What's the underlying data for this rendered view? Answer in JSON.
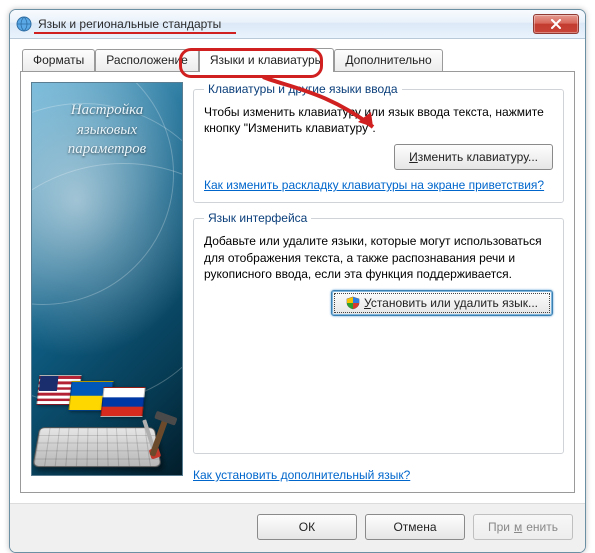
{
  "window": {
    "title": "Язык и региональные стандарты"
  },
  "tabs": [
    {
      "label": "Форматы"
    },
    {
      "label": "Расположение"
    },
    {
      "label": "Языки и клавиатуры"
    },
    {
      "label": "Дополнительно"
    }
  ],
  "sidebar": {
    "line1": "Настройка",
    "line2": "языковых",
    "line3": "параметров"
  },
  "group_keyboards": {
    "legend": "Клавиатуры и другие языки ввода",
    "desc": "Чтобы изменить клавиатуру или язык ввода текста, нажмите кнопку \"Изменить клавиатуру\".",
    "button_pre": "И",
    "button_rest": "зменить клавиатуру...",
    "link": "Как изменить раскладку клавиатуры на экране приветствия?"
  },
  "group_interface": {
    "legend": "Язык интерфейса",
    "desc": "Добавьте или удалите языки, которые могут использоваться для отображения текста, а также распознавания речи и рукописного ввода, если эта функция поддерживается.",
    "button_pre": "У",
    "button_rest": "становить или удалить язык..."
  },
  "footer_link": "Как установить дополнительный язык?",
  "buttons": {
    "ok": "ОК",
    "cancel": "Отмена",
    "apply_pre": "При",
    "apply_u": "м",
    "apply_post": "енить"
  }
}
